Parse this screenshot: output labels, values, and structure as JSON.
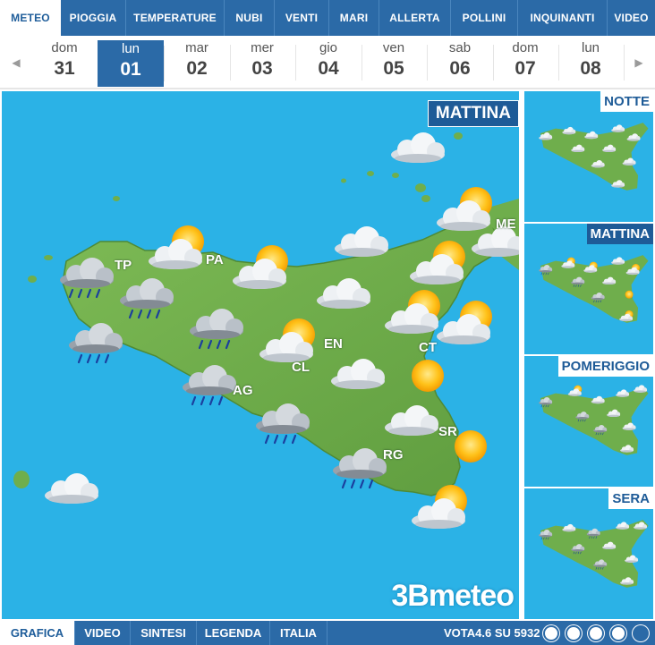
{
  "topnav": {
    "tabs": [
      {
        "label": "METEO",
        "active": true
      },
      {
        "label": "PIOGGIA"
      },
      {
        "label": "TEMPERATURE"
      },
      {
        "label": "NUBI"
      },
      {
        "label": "VENTI"
      },
      {
        "label": "MARI"
      },
      {
        "label": "ALLERTA"
      },
      {
        "label": "POLLINI"
      },
      {
        "label": "INQUINANTI"
      },
      {
        "label": "VIDEO"
      }
    ]
  },
  "days": [
    {
      "name": "dom",
      "num": "31"
    },
    {
      "name": "lun",
      "num": "01",
      "selected": true
    },
    {
      "name": "mar",
      "num": "02"
    },
    {
      "name": "mer",
      "num": "03"
    },
    {
      "name": "gio",
      "num": "04"
    },
    {
      "name": "ven",
      "num": "05"
    },
    {
      "name": "sab",
      "num": "06"
    },
    {
      "name": "dom",
      "num": "07"
    },
    {
      "name": "lun",
      "num": "08"
    }
  ],
  "nav": {
    "prev": "◀",
    "next": "▶"
  },
  "main": {
    "period": "MATTINA",
    "brand": "3Bmeteo"
  },
  "cities": {
    "TP": "TP",
    "PA": "PA",
    "ME": "ME",
    "EN": "EN",
    "CL": "CL",
    "CT": "CT",
    "AG": "AG",
    "SR": "SR",
    "RG": "RG"
  },
  "side": {
    "p0": "NOTTE",
    "p1": "MATTINA",
    "p2": "POMERIGGIO",
    "p3": "SERA"
  },
  "bottom": {
    "tabs": [
      {
        "label": "GRAFICA",
        "active": true
      },
      {
        "label": "VIDEO"
      },
      {
        "label": "SINTESI"
      },
      {
        "label": "LEGENDA"
      },
      {
        "label": "ITALIA"
      }
    ],
    "vote": "VOTA4.6 SU 5932"
  },
  "colors": {
    "nav": "#2b6aa7",
    "sea": "#2bb2e6",
    "land": "#6fae4c",
    "label": "#1e5b97"
  }
}
